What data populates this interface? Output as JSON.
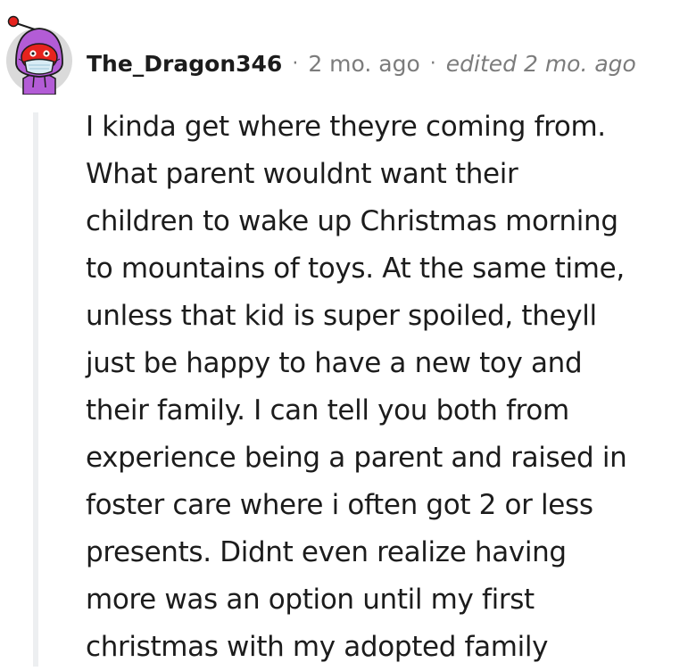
{
  "comment": {
    "author": "The_Dragon346",
    "separator": "·",
    "timestamp": "2 mo. ago",
    "edited": "edited 2 mo. ago",
    "avatar_icon": "snoo-avatar-icon",
    "body_lines": [
      "I kinda get where theyre coming from.",
      "What parent wouldnt want their",
      "children to wake up Christmas morning",
      "to mountains of toys. At the same time,",
      "unless that kid is super spoiled, theyll",
      "just be happy to have a new toy and",
      "their family. I can tell you both from",
      "experience being a parent and raised in",
      "foster care where i often got 2 or less",
      "presents. Didnt even realize having",
      "more was an option until my first",
      "christmas with my adopted family"
    ]
  },
  "colors": {
    "text": "#1c1c1c",
    "meta": "#7c7c7c",
    "thread_line": "#edeff1",
    "avatar_hood": "#b35cd6",
    "avatar_face": "#e6231e",
    "avatar_bg": "#dadada"
  }
}
